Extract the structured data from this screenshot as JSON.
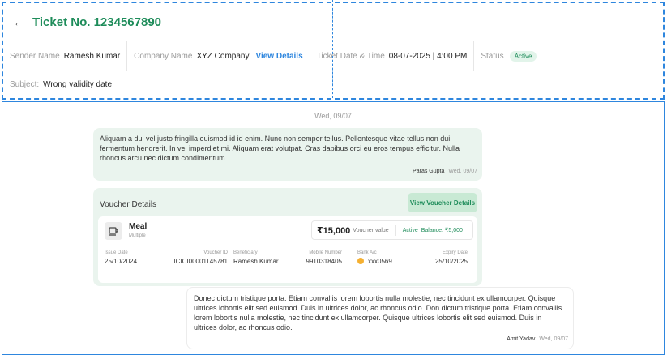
{
  "header": {
    "title": "Ticket No. 1234567890",
    "sender": {
      "label": "Sender Name",
      "value": "Ramesh Kumar"
    },
    "company": {
      "label": "Company Name",
      "value": "XYZ Company",
      "link": "View Details"
    },
    "ticket_datetime": {
      "label": "Ticket Date & Time",
      "value": "08-07-2025 | 4:00 PM"
    },
    "status": {
      "label": "Status",
      "value": "Active"
    },
    "subject": {
      "label": "Subject:",
      "value": "Wrong validity date"
    }
  },
  "chat": {
    "date_separator": "Wed, 09/07",
    "messages": [
      {
        "text": "Aliquam a dui vel justo fringilla euismod id id enim. Nunc non semper tellus. Pellentesque vitae tellus non dui fermentum hendrerit. In vel imperdiet mi. Aliquam erat volutpat. Cras dapibus orci eu eros tempus efficitur. Nulla rhoncus arcu nec dictum condimentum.",
        "author": "Paras Gupta",
        "time": "Wed, 09/07"
      },
      {
        "text": "Donec dictum tristique porta. Etiam convallis lorem lobortis nulla molestie, nec tincidunt ex ullamcorper. Quisque ultrices lobortis elit sed euismod. Duis in ultrices dolor, ac rhoncus odio. Don dictum tristique porta. Etiam convallis lorem lobortis nulla molestie, nec tincidunt ex ullamcorper. Quisque ultrices lobortis elit sed euismod. Duis in ultrices dolor, ac rhoncus odio.",
        "author": "Amit Yadav",
        "time": "Wed, 09/07"
      }
    ],
    "voucher": {
      "title": "Voucher Details",
      "button": "View Voucher Details",
      "name": "Meal",
      "subtitle": "Multiple",
      "amount": "₹15,000",
      "amount_label": "Voucher value",
      "active": "Active",
      "balance": "Balance: ₹5,000",
      "fields": [
        {
          "label": "Issue Date",
          "value": "25/10/2024"
        },
        {
          "label": "Voucher ID",
          "value": "ICICI00001145781"
        },
        {
          "label": "Beneficiary",
          "value": "Ramesh Kumar"
        },
        {
          "label": "Mobile Number",
          "value": "9910318405"
        },
        {
          "label": "Bank A/c",
          "value": "xxx0569"
        },
        {
          "label": "Expiry Date",
          "value": "25/10/2025"
        }
      ]
    }
  },
  "icons": {
    "back": "arrow-left-icon",
    "voucher": "coffee-cup-icon",
    "bank": "bank-logo-icon"
  },
  "colors": {
    "accent": "#1e8c5a",
    "link": "#2e86de",
    "bubble": "#eaf4ee"
  }
}
